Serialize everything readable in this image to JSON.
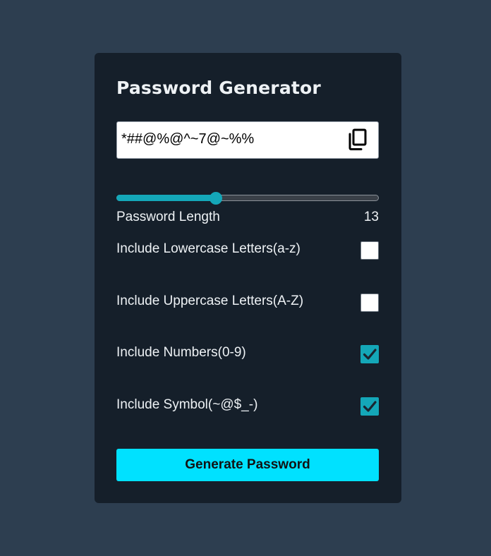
{
  "app": {
    "title": "Password Generator"
  },
  "password": {
    "value": "*##@%@^~7@~%%",
    "copy_icon": "copy-icon"
  },
  "length": {
    "label": "Password Length",
    "value": "13",
    "slider_fraction": 0.38
  },
  "options": [
    {
      "label": "Include Lowercase Letters(a-z)",
      "checked": false
    },
    {
      "label": "Include Uppercase Letters(A-Z)",
      "checked": false
    },
    {
      "label": "Include Numbers(0-9)",
      "checked": true
    },
    {
      "label": "Include Symbol(~@$_-)",
      "checked": true
    }
  ],
  "actions": {
    "generate_label": "Generate Password"
  },
  "colors": {
    "background": "#2d3e50",
    "card": "#151f2a",
    "accent": "#14a7b8",
    "button": "#00e1ff"
  }
}
